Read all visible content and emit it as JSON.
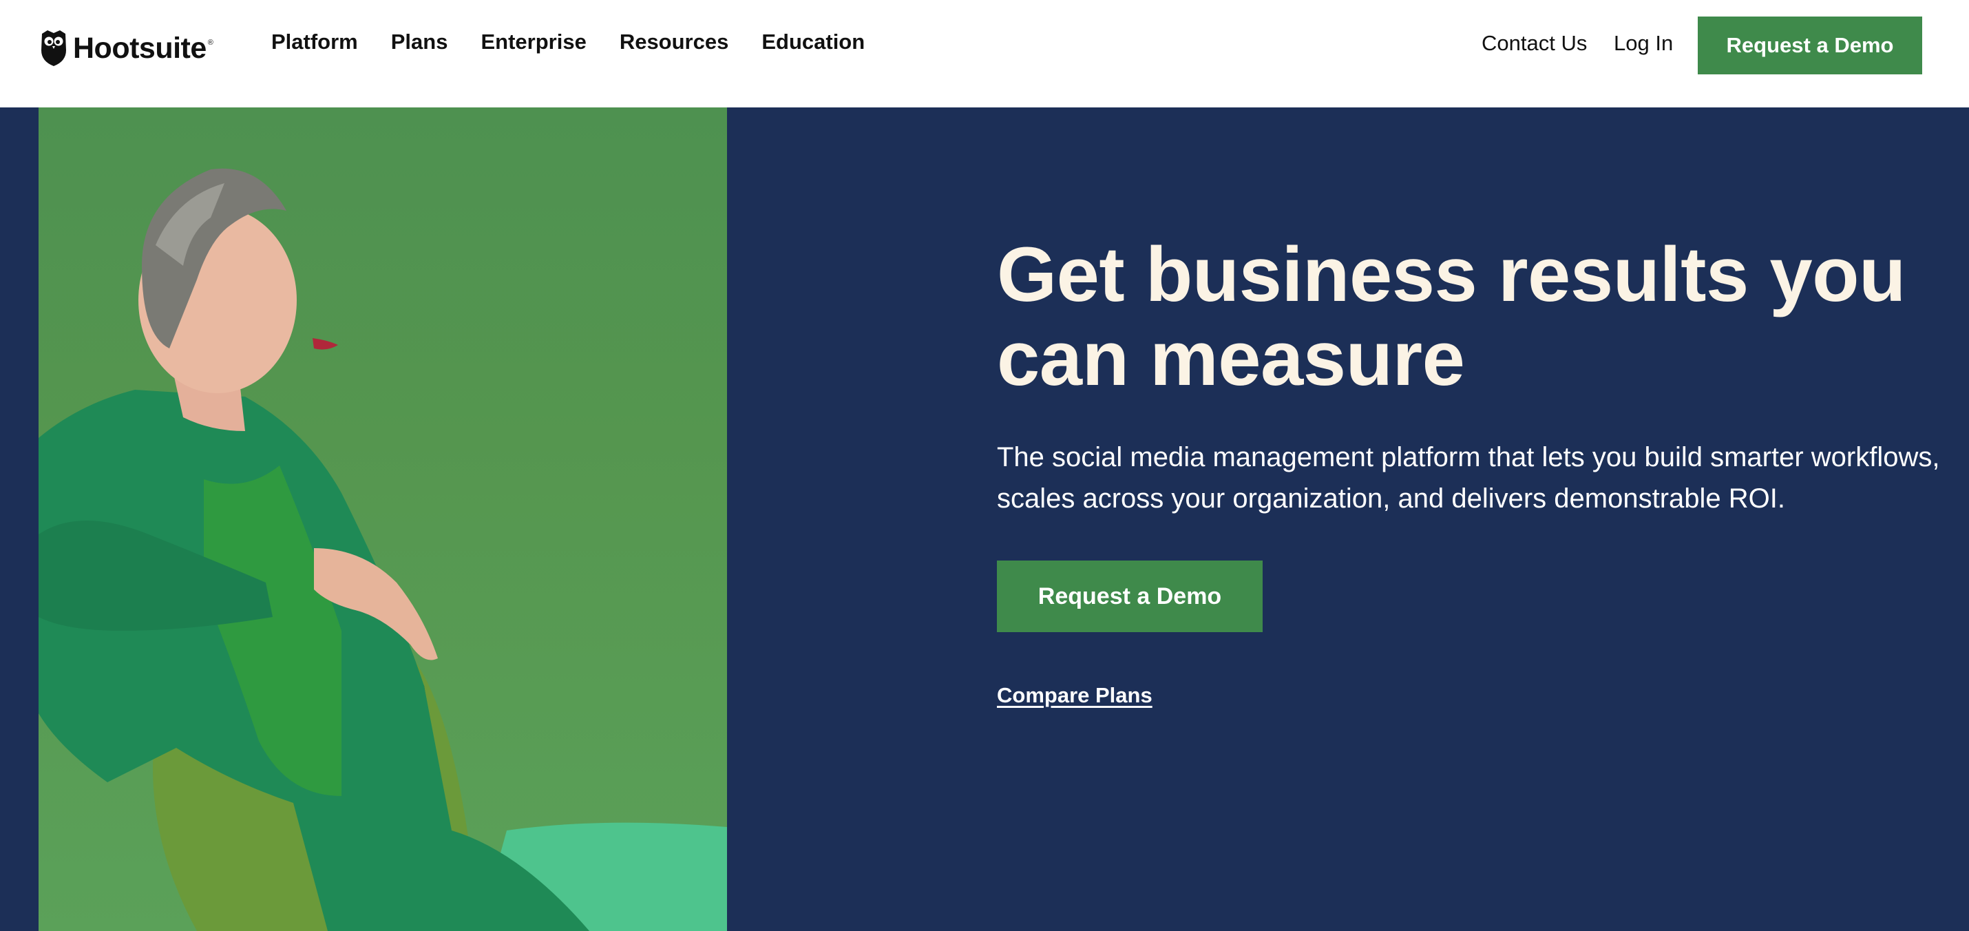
{
  "header": {
    "logo_text": "Hootsuite",
    "logo_mark": "®",
    "nav": [
      {
        "label": "Platform"
      },
      {
        "label": "Plans"
      },
      {
        "label": "Enterprise"
      },
      {
        "label": "Resources"
      },
      {
        "label": "Education"
      }
    ],
    "contact_label": "Contact Us",
    "login_label": "Log In",
    "cta_label": "Request a Demo"
  },
  "hero": {
    "headline": "Get business results you can measure",
    "subhead": "The social media management platform that lets you build smarter workflows, scales across your organization, and delivers demonstrable ROI.",
    "cta_label": "Request a Demo",
    "secondary_link": "Compare Plans"
  },
  "colors": {
    "brand_green": "#3f8a4b",
    "hero_background": "#1c2f57",
    "headline": "#fbf3e5",
    "image_background": "#55964f"
  },
  "icons": {
    "logo": "owl-logo-icon"
  }
}
